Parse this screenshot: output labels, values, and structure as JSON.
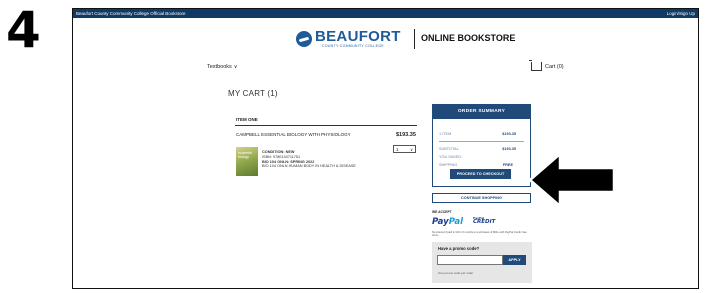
{
  "step_number": "4",
  "topbar": {
    "left_text": "Beaufort County Community College Official Bookstore",
    "right_text": "Login/Sign Up"
  },
  "header": {
    "logo_name": "BEAUFORT",
    "logo_sub": "COUNTY COMMUNITY COLLEGE",
    "store_title": "ONLINE BOOKSTORE",
    "brand_color": "#1f5a99"
  },
  "nav": {
    "textbooks_label": "Textbooks",
    "textbooks_icon": "chevron-down-icon",
    "cart_label": "Cart (0)",
    "cart_icon": "shopping-cart-icon"
  },
  "cart": {
    "title": "MY CART (1)",
    "section_label": "ITEM ONE",
    "item": {
      "title": "CAMPBELL ESSENTIAL BIOLOGY WITH PHYSIOLOGY",
      "price": "$193.35",
      "quantity": "1",
      "cover_text": "essential biology",
      "condition": "CONDITION: NEW",
      "isbn": "ISBN: 9780134711751",
      "course": "BIO 104 ONLN: SPRING 2022",
      "course_desc": "BIO 104 ONLN HUMAN BODY IN HEALTH & DISEASE"
    }
  },
  "summary": {
    "header": "ORDER SUMMARY",
    "item_label": "1 ITEM",
    "item_value": "$193.35",
    "subtotal_label": "SUBTOTAL",
    "subtotal_value": "$193.35",
    "saved_label": "YOU SAVED:",
    "shipping_label": "SHIPPING",
    "shipping_value": "FREE",
    "checkout_label": "PROCEED TO CHECKOUT",
    "accent_color": "#1f4a7a"
  },
  "continue_shopping_label": "CONTINUE SHOPPING",
  "payment": {
    "we_accept": "WE ACCEPT",
    "paypal_a": "Pay",
    "paypal_b": "Pal",
    "paypal_credit_top": "PayPal",
    "paypal_credit_bottom": "CREDIT",
    "note": "No interest if paid in full in 6 months on purchases of $99+ with PayPal Credit. See terms"
  },
  "promo": {
    "label": "Have a promo code?",
    "input_value": "",
    "apply_label": "APPLY",
    "footer": "One promo code per order"
  },
  "annotation": {
    "arrow_icon": "left-arrow-icon"
  }
}
